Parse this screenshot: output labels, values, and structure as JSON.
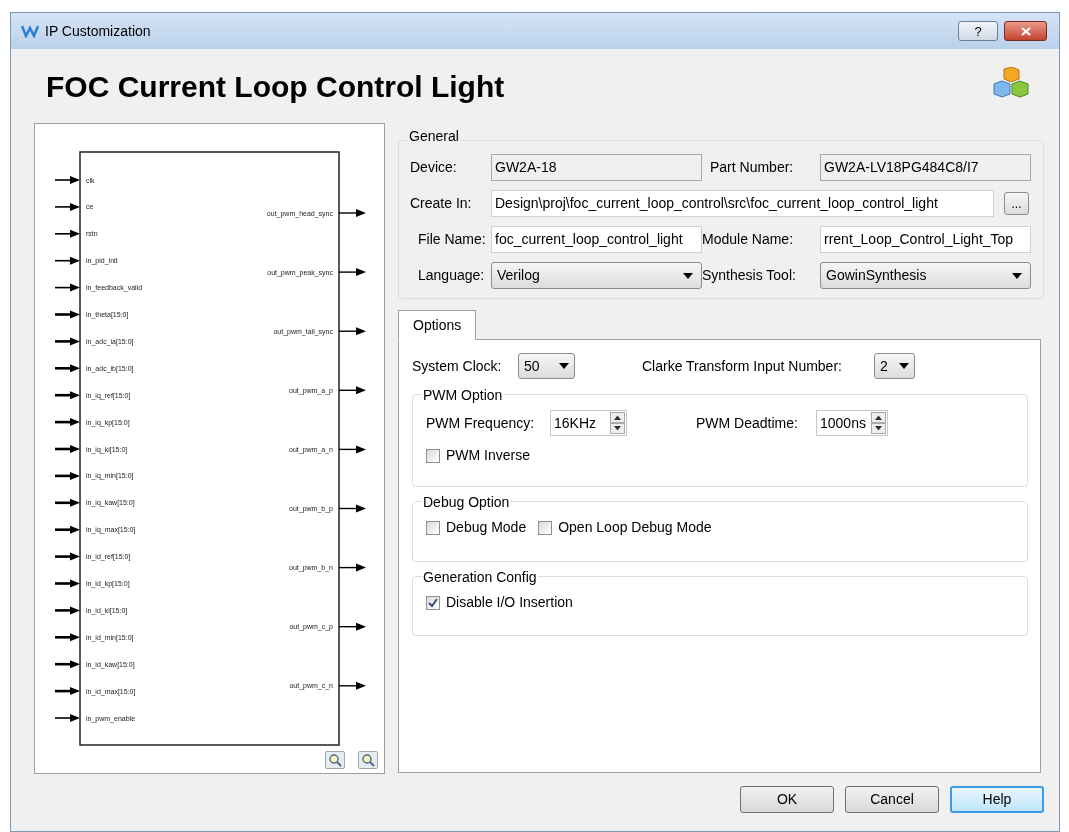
{
  "window": {
    "title": "IP Customization",
    "help_glyph": "?"
  },
  "heading": "FOC Current Loop Control Light",
  "diagram": {
    "inputs": [
      "clk",
      "ce",
      "rstn",
      "in_pid_init",
      "in_feedback_valid",
      "in_theta[15:0]",
      "in_adc_ia[15:0]",
      "in_adc_ib[15:0]",
      "in_iq_ref[15:0]",
      "in_iq_kp[15:0]",
      "in_iq_ki[15:0]",
      "in_iq_min[15:0]",
      "in_iq_kaw[15:0]",
      "in_iq_max[15:0]",
      "in_id_ref[15:0]",
      "in_id_kp[15:0]",
      "in_id_ki[15:0]",
      "in_id_min[15:0]",
      "in_id_kaw[15:0]",
      "in_id_max[15:0]",
      "in_pwm_enable"
    ],
    "outputs": [
      "out_pwm_head_sync",
      "out_pwm_peak_sync",
      "out_pwm_tail_sync",
      "out_pwm_a_p",
      "out_pwm_a_n",
      "out_pwm_b_p",
      "out_pwm_b_n",
      "out_pwm_c_p",
      "out_pwm_c_n"
    ]
  },
  "general": {
    "title": "General",
    "fields": [
      {
        "kind": "readonly",
        "label": "Device:",
        "value": "GW2A-18"
      },
      {
        "kind": "readonly",
        "label": "Part Number:",
        "value": "GW2A-LV18PG484C8/I7"
      },
      {
        "kind": "path",
        "label": "Create In:",
        "value": "Design\\proj\\foc_current_loop_control\\src\\foc_current_loop_control_light",
        "button": "..."
      },
      {
        "kind": "text",
        "label": "File Name:",
        "value": "foc_current_loop_control_light"
      },
      {
        "kind": "text",
        "label": "Module Name:",
        "value": "rrent_Loop_Control_Light_Top"
      },
      {
        "kind": "dropdown",
        "label": "Language:",
        "value": "Verilog"
      },
      {
        "kind": "dropdown",
        "label": "Synthesis Tool:",
        "value": "GowinSynthesis"
      }
    ]
  },
  "tabs": [
    {
      "label": "Options",
      "selected": true
    }
  ],
  "options": {
    "system_clock": {
      "label": "System Clock:",
      "value": "50"
    },
    "clarke": {
      "label": "Clarke Transform Input Number:",
      "value": "2"
    },
    "groups": [
      {
        "title": "PWM Option",
        "spinners": [
          {
            "label": "PWM Frequency:",
            "value": "16KHz"
          },
          {
            "label": "PWM Deadtime:",
            "value": "1000ns"
          }
        ],
        "checkboxes": [
          {
            "label": "PWM Inverse",
            "checked": false
          }
        ]
      },
      {
        "title": "Debug Option",
        "checkboxes": [
          {
            "label": "Debug Mode",
            "checked": false
          },
          {
            "label": "Open Loop Debug Mode",
            "checked": false
          }
        ]
      },
      {
        "title": "Generation Config",
        "checkboxes": [
          {
            "label": "Disable I/O Insertion",
            "checked": true
          }
        ]
      }
    ]
  },
  "buttons": [
    {
      "label": "OK",
      "focused": false
    },
    {
      "label": "Cancel",
      "focused": false
    },
    {
      "label": "Help",
      "focused": true
    }
  ]
}
